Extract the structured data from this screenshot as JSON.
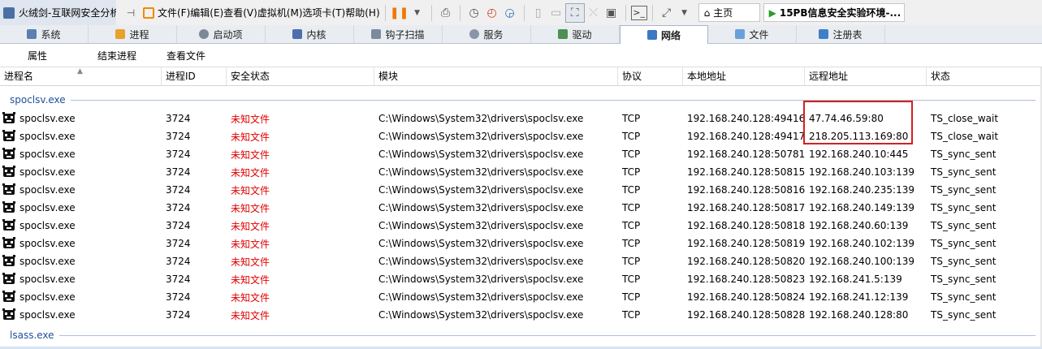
{
  "app": {
    "title": "火绒剑-互联网安全分析"
  },
  "menu": [
    "文件(F)",
    "编辑(E)",
    "查看(V)",
    "虚拟机(M)",
    "选项卡(T)",
    "帮助(H)"
  ],
  "browser_tabs": {
    "home": "主页",
    "vm": "15PB信息安全实验环境-..."
  },
  "module_tabs": [
    "系统",
    "进程",
    "启动项",
    "内核",
    "钩子扫描",
    "服务",
    "驱动",
    "网络",
    "文件",
    "注册表"
  ],
  "active_tab": "网络",
  "actions": [
    "属性",
    "结束进程",
    "查看文件"
  ],
  "columns": [
    "进程名",
    "进程ID",
    "安全状态",
    "模块",
    "协议",
    "本地地址",
    "远程地址",
    "状态"
  ],
  "groups": [
    {
      "label": "spoclsv.exe",
      "rows": [
        {
          "name": "spoclsv.exe",
          "pid": "3724",
          "security": "未知文件",
          "module": "C:\\Windows\\System32\\drivers\\spoclsv.exe",
          "protocol": "TCP",
          "local": "192.168.240.128:49416",
          "remote": "47.74.46.59:80",
          "state": "TS_close_wait"
        },
        {
          "name": "spoclsv.exe",
          "pid": "3724",
          "security": "未知文件",
          "module": "C:\\Windows\\System32\\drivers\\spoclsv.exe",
          "protocol": "TCP",
          "local": "192.168.240.128:49417",
          "remote": "218.205.113.169:80",
          "state": "TS_close_wait"
        },
        {
          "name": "spoclsv.exe",
          "pid": "3724",
          "security": "未知文件",
          "module": "C:\\Windows\\System32\\drivers\\spoclsv.exe",
          "protocol": "TCP",
          "local": "192.168.240.128:50781",
          "remote": "192.168.240.10:445",
          "state": "TS_sync_sent"
        },
        {
          "name": "spoclsv.exe",
          "pid": "3724",
          "security": "未知文件",
          "module": "C:\\Windows\\System32\\drivers\\spoclsv.exe",
          "protocol": "TCP",
          "local": "192.168.240.128:50815",
          "remote": "192.168.240.103:139",
          "state": "TS_sync_sent"
        },
        {
          "name": "spoclsv.exe",
          "pid": "3724",
          "security": "未知文件",
          "module": "C:\\Windows\\System32\\drivers\\spoclsv.exe",
          "protocol": "TCP",
          "local": "192.168.240.128:50816",
          "remote": "192.168.240.235:139",
          "state": "TS_sync_sent"
        },
        {
          "name": "spoclsv.exe",
          "pid": "3724",
          "security": "未知文件",
          "module": "C:\\Windows\\System32\\drivers\\spoclsv.exe",
          "protocol": "TCP",
          "local": "192.168.240.128:50817",
          "remote": "192.168.240.149:139",
          "state": "TS_sync_sent"
        },
        {
          "name": "spoclsv.exe",
          "pid": "3724",
          "security": "未知文件",
          "module": "C:\\Windows\\System32\\drivers\\spoclsv.exe",
          "protocol": "TCP",
          "local": "192.168.240.128:50818",
          "remote": "192.168.240.60:139",
          "state": "TS_sync_sent"
        },
        {
          "name": "spoclsv.exe",
          "pid": "3724",
          "security": "未知文件",
          "module": "C:\\Windows\\System32\\drivers\\spoclsv.exe",
          "protocol": "TCP",
          "local": "192.168.240.128:50819",
          "remote": "192.168.240.102:139",
          "state": "TS_sync_sent"
        },
        {
          "name": "spoclsv.exe",
          "pid": "3724",
          "security": "未知文件",
          "module": "C:\\Windows\\System32\\drivers\\spoclsv.exe",
          "protocol": "TCP",
          "local": "192.168.240.128:50820",
          "remote": "192.168.240.100:139",
          "state": "TS_sync_sent"
        },
        {
          "name": "spoclsv.exe",
          "pid": "3724",
          "security": "未知文件",
          "module": "C:\\Windows\\System32\\drivers\\spoclsv.exe",
          "protocol": "TCP",
          "local": "192.168.240.128:50823",
          "remote": "192.168.241.5:139",
          "state": "TS_sync_sent"
        },
        {
          "name": "spoclsv.exe",
          "pid": "3724",
          "security": "未知文件",
          "module": "C:\\Windows\\System32\\drivers\\spoclsv.exe",
          "protocol": "TCP",
          "local": "192.168.240.128:50824",
          "remote": "192.168.241.12:139",
          "state": "TS_sync_sent"
        },
        {
          "name": "spoclsv.exe",
          "pid": "3724",
          "security": "未知文件",
          "module": "C:\\Windows\\System32\\drivers\\spoclsv.exe",
          "protocol": "TCP",
          "local": "192.168.240.128:50828",
          "remote": "192.168.240.128:80",
          "state": "TS_sync_sent"
        }
      ]
    },
    {
      "label": "lsass.exe",
      "rows": []
    }
  ],
  "colors": {
    "unknown": "#e00000",
    "highlight": "#d42020",
    "group_label": "#1f4e9c"
  }
}
